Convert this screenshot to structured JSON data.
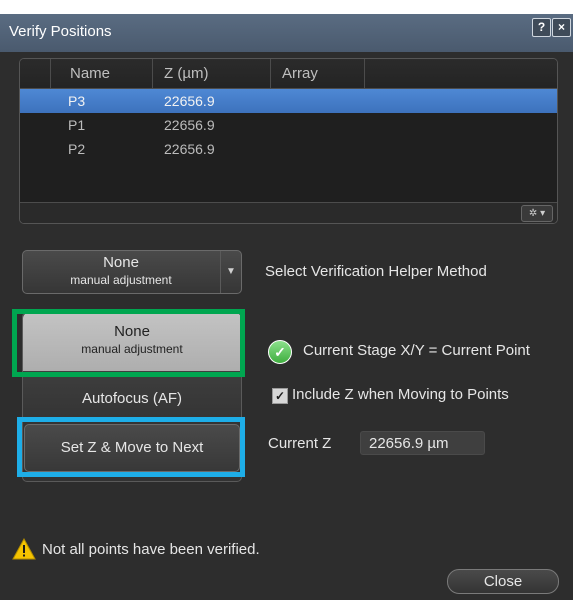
{
  "window": {
    "title": "Verify Positions",
    "help_label": "?",
    "close_label": "×"
  },
  "table": {
    "columns": [
      "Name",
      "Z (µm)",
      "Array"
    ],
    "rows": [
      {
        "name": "P3",
        "z": "22656.9",
        "array": "",
        "selected": true
      },
      {
        "name": "P1",
        "z": "22656.9",
        "array": "",
        "selected": false
      },
      {
        "name": "P2",
        "z": "22656.9",
        "array": "",
        "selected": false
      }
    ],
    "options_button": "✲ ▾"
  },
  "helper": {
    "selected": {
      "line1": "None",
      "line2": "manual adjustment"
    },
    "label": "Select Verification Helper Method",
    "options": [
      {
        "line1": "None",
        "line2": "manual adjustment"
      },
      {
        "line1": "Autofocus (AF)",
        "line2": ""
      }
    ]
  },
  "actions": {
    "set_z_next": "Set Z & Move to Next",
    "close": "Close"
  },
  "status": {
    "check_glyph": "✓",
    "text": "Current Stage X/Y  =  Current Point"
  },
  "include_z": {
    "checked": true,
    "glyph": "✓",
    "label": "Include Z when Moving to Points"
  },
  "current_z": {
    "label": "Current Z",
    "value": "22656.9 µm"
  },
  "warning": {
    "text": "Not all points have been verified."
  },
  "colors": {
    "highlight_green": "#00a650",
    "highlight_blue": "#1eaee8",
    "selection_blue": "#4e88d4",
    "warning_yellow": "#f5c400"
  }
}
